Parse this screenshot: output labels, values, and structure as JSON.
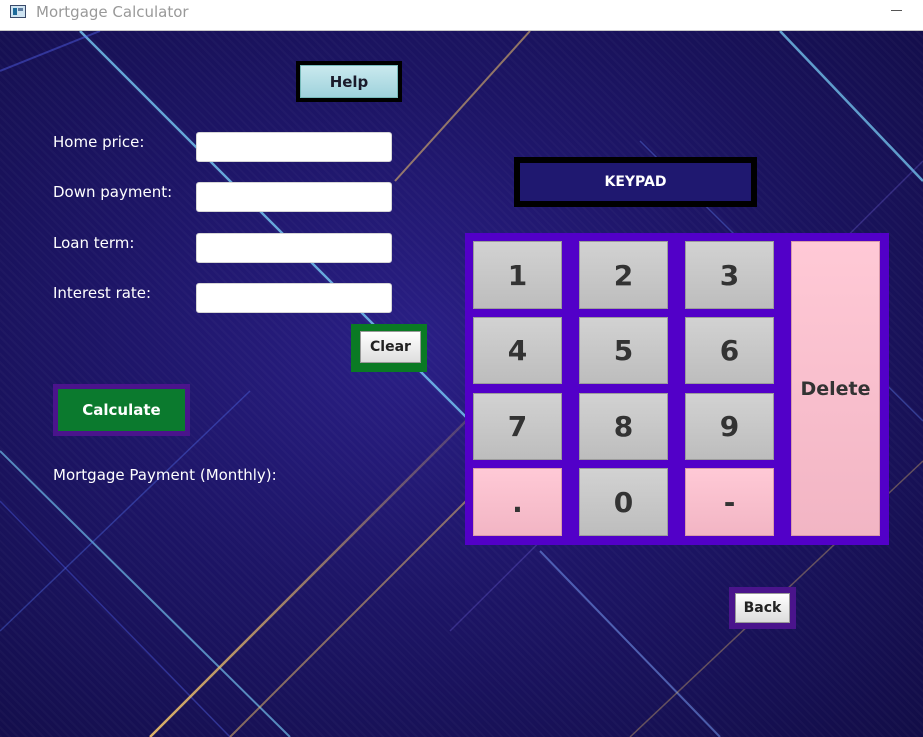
{
  "window": {
    "title": "Mortgage Calculator",
    "icon": "app-window-icon",
    "minimize_icon": "minimize-icon"
  },
  "theme": {
    "background": "#1d1566",
    "keypad_border": "#5200c8",
    "calculate_green": "#0b7a2e",
    "clear_border": "#0a7a24",
    "pink_key": "#ffc9d6",
    "gray_key": "#c8c8c8",
    "help_face": "#b5dfe6"
  },
  "form": {
    "help_label": "Help",
    "fields": [
      {
        "label": "Home price:",
        "value": "",
        "placeholder": ""
      },
      {
        "label": "Down payment:",
        "value": "",
        "placeholder": ""
      },
      {
        "label": "Loan term:",
        "value": "",
        "placeholder": ""
      },
      {
        "label": "Interest rate:",
        "value": "",
        "placeholder": ""
      }
    ],
    "clear_label": "Clear",
    "calculate_label": "Calculate",
    "result_label": "Mortgage Payment (Monthly):"
  },
  "keypad": {
    "title": "KEYPAD",
    "keys": [
      "1",
      "2",
      "3",
      "4",
      "5",
      "6",
      "7",
      "8",
      "9",
      ".",
      "0",
      "-"
    ],
    "delete_label": "Delete",
    "back_label": "Back"
  }
}
